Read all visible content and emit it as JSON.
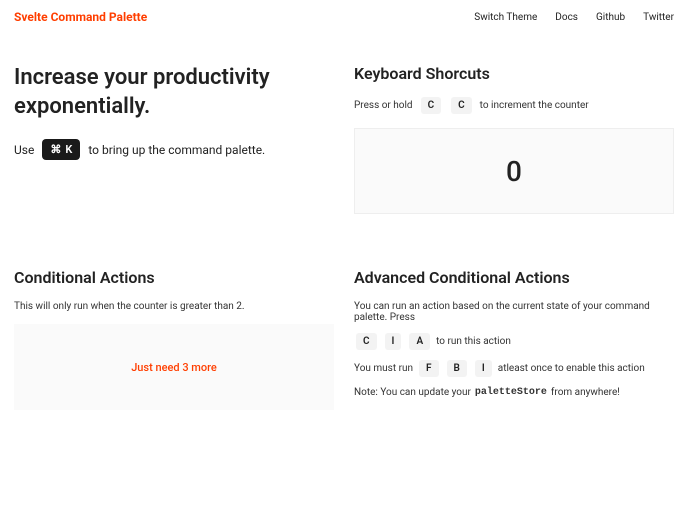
{
  "header": {
    "brand": "Svelte Command Palette",
    "nav": [
      "Switch Theme",
      "Docs",
      "Github",
      "Twitter"
    ]
  },
  "hero": {
    "title": "Increase your productivity exponentially.",
    "sub_before": "Use",
    "kbd_cmd": "⌘",
    "kbd_k": "K",
    "sub_after": "to bring up the command palette."
  },
  "shortcuts": {
    "title": "Keyboard Shorcuts",
    "press_hold": "Press or hold",
    "key1": "C",
    "key2": "C",
    "to_increment": "to increment the counter",
    "counter": "0"
  },
  "conditional": {
    "title": "Conditional Actions",
    "desc": "This will only run when the counter is greater than 2.",
    "status": "Just need 3 more"
  },
  "advanced": {
    "title": "Advanced Conditional Actions",
    "line1_pre": "You can run an action based on the current state of your command palette. Press",
    "k1": "C",
    "k2": "I",
    "k3": "A",
    "line1_post": "to run this action",
    "line2_pre": "You must run",
    "k4": "F",
    "k5": "B",
    "k6": "I",
    "line2_post": "atleast once to enable this action",
    "note_pre": "Note: You can update your",
    "note_code": "paletteStore",
    "note_post": "from anywhere!"
  }
}
